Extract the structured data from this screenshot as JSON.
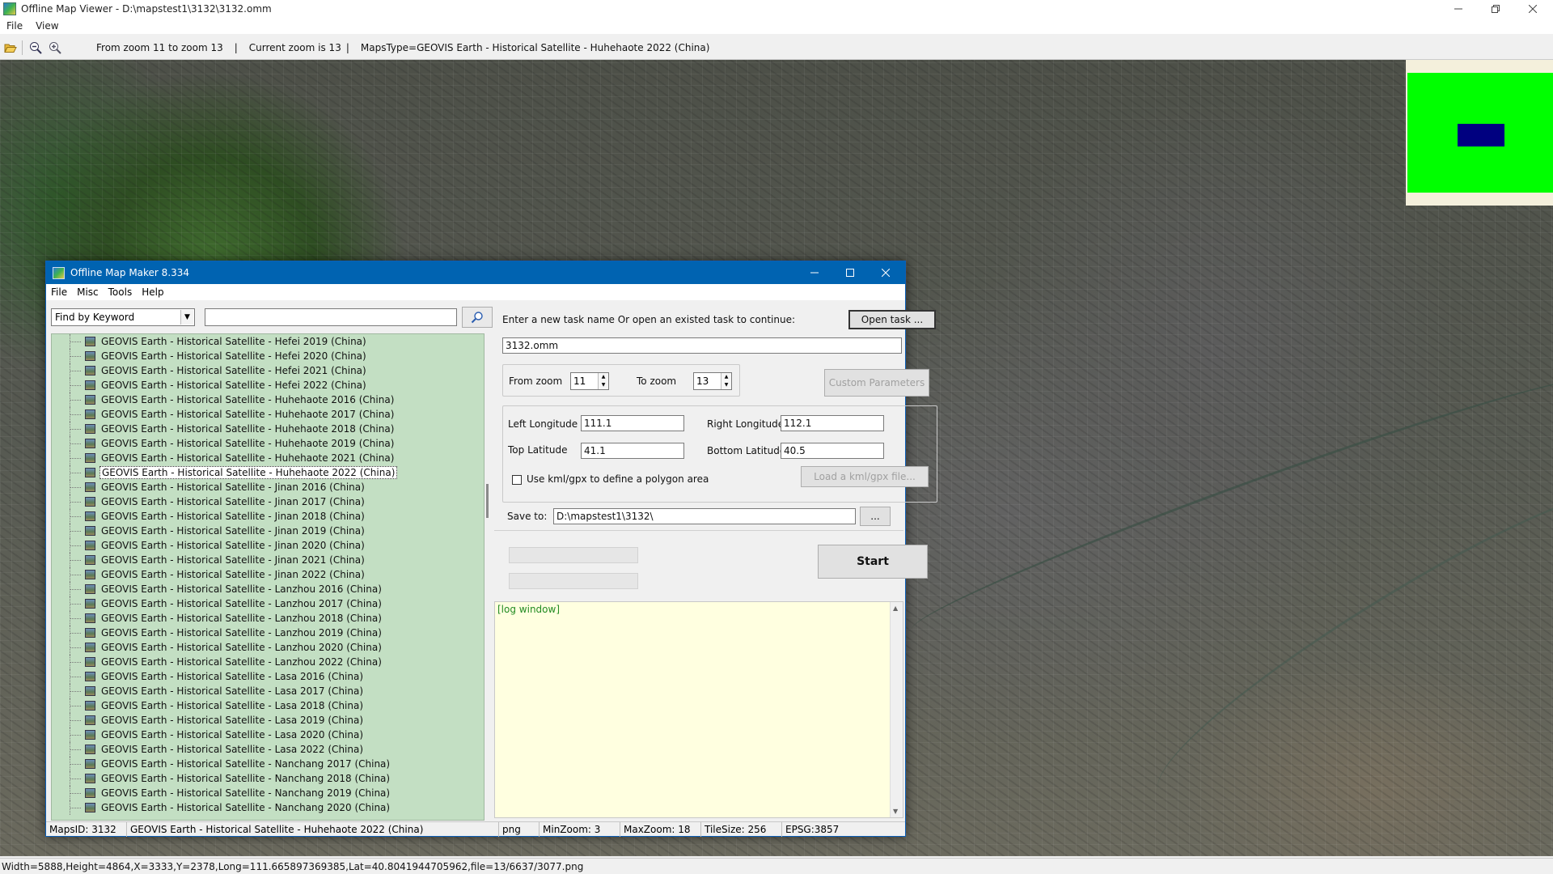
{
  "viewer": {
    "title": "Offline Map Viewer - D:\\mapstest1\\3132\\3132.omm",
    "menu": [
      "File",
      "View"
    ],
    "toolbar": {
      "zoom_range": "From zoom 11 to zoom 13",
      "current_zoom": "Current zoom is 13",
      "maps_type": "MapsType=GEOVIS Earth - Historical Satellite - Huhehaote 2022 (China)"
    },
    "status": "Width=5888,Height=4864,X=3333,Y=2378,Long=111.665897369385,Lat=40.8041944705962,file=13/6637/3077.png"
  },
  "maker": {
    "title": "Offline Map Maker 8.334",
    "menu": [
      "File",
      "Misc",
      "Tools",
      "Help"
    ],
    "search": {
      "mode": "Find by Keyword",
      "keyword": ""
    },
    "map_list": [
      "GEOVIS Earth - Historical Satellite - Hefei 2019 (China)",
      "GEOVIS Earth - Historical Satellite - Hefei 2020 (China)",
      "GEOVIS Earth - Historical Satellite - Hefei 2021 (China)",
      "GEOVIS Earth - Historical Satellite - Hefei 2022 (China)",
      "GEOVIS Earth - Historical Satellite - Huhehaote 2016 (China)",
      "GEOVIS Earth - Historical Satellite - Huhehaote 2017 (China)",
      "GEOVIS Earth - Historical Satellite - Huhehaote 2018 (China)",
      "GEOVIS Earth - Historical Satellite - Huhehaote 2019 (China)",
      "GEOVIS Earth - Historical Satellite - Huhehaote 2021 (China)",
      "GEOVIS Earth - Historical Satellite - Huhehaote 2022 (China)",
      "GEOVIS Earth - Historical Satellite - Jinan 2016 (China)",
      "GEOVIS Earth - Historical Satellite - Jinan 2017 (China)",
      "GEOVIS Earth - Historical Satellite - Jinan 2018 (China)",
      "GEOVIS Earth - Historical Satellite - Jinan 2019 (China)",
      "GEOVIS Earth - Historical Satellite - Jinan 2020 (China)",
      "GEOVIS Earth - Historical Satellite - Jinan 2021 (China)",
      "GEOVIS Earth - Historical Satellite - Jinan 2022 (China)",
      "GEOVIS Earth - Historical Satellite - Lanzhou 2016 (China)",
      "GEOVIS Earth - Historical Satellite - Lanzhou 2017 (China)",
      "GEOVIS Earth - Historical Satellite - Lanzhou 2018 (China)",
      "GEOVIS Earth - Historical Satellite - Lanzhou 2019 (China)",
      "GEOVIS Earth - Historical Satellite - Lanzhou 2020 (China)",
      "GEOVIS Earth - Historical Satellite - Lanzhou 2022 (China)",
      "GEOVIS Earth - Historical Satellite - Lasa 2016 (China)",
      "GEOVIS Earth - Historical Satellite - Lasa 2017 (China)",
      "GEOVIS Earth - Historical Satellite - Lasa 2018 (China)",
      "GEOVIS Earth - Historical Satellite - Lasa 2019 (China)",
      "GEOVIS Earth - Historical Satellite - Lasa 2020 (China)",
      "GEOVIS Earth - Historical Satellite - Lasa 2022 (China)",
      "GEOVIS Earth - Historical Satellite - Nanchang 2017 (China)",
      "GEOVIS Earth - Historical Satellite - Nanchang 2018 (China)",
      "GEOVIS Earth - Historical Satellite - Nanchang 2019 (China)",
      "GEOVIS Earth - Historical Satellite - Nanchang 2020 (China)"
    ],
    "selected_map_index": 9,
    "task": {
      "prompt": "Enter a new task name Or open an existed task to continue:",
      "open_task_label": "Open task ...",
      "task_name": "3132.omm",
      "from_zoom_label": "From zoom",
      "from_zoom": "11",
      "to_zoom_label": "To zoom",
      "to_zoom": "13",
      "custom_params_label": "Custom Parameters",
      "left_longitude_label": "Left Longitude",
      "left_longitude": "111.1",
      "right_longitude_label": "Right Longitude",
      "right_longitude": "112.1",
      "top_latitude_label": "Top Latitude",
      "top_latitude": "41.1",
      "bottom_latitude_label": "Bottom Latitude",
      "bottom_latitude": "40.5",
      "kml_checkbox_label": "Use kml/gpx to define a polygon area",
      "kml_checked": false,
      "load_kml_label": "Load a kml/gpx file...",
      "save_to_label": "Save to:",
      "save_to": "D:\\mapstest1\\3132\\",
      "browse_label": "...",
      "start_label": "Start"
    },
    "log_text": "[log window]",
    "status": {
      "maps_id": "MapsID: 3132",
      "map_name": "GEOVIS Earth - Historical Satellite - Huhehaote 2022 (China)",
      "format": "png",
      "min_zoom": "MinZoom: 3",
      "max_zoom": "MaxZoom: 18",
      "tile_size": "TileSize: 256",
      "epsg": "EPSG:3857"
    }
  },
  "colors": {
    "dialog_titlebar": "#0063b1",
    "list_background": "#c3dfc3",
    "log_background": "#ffffe0",
    "minimap_area": "#00ff00",
    "minimap_viewport": "#000080"
  },
  "icons": [
    "folder-open-icon",
    "zoom-out-icon",
    "zoom-in-icon",
    "search-icon",
    "minimize-icon",
    "maximize-icon",
    "close-icon"
  ]
}
